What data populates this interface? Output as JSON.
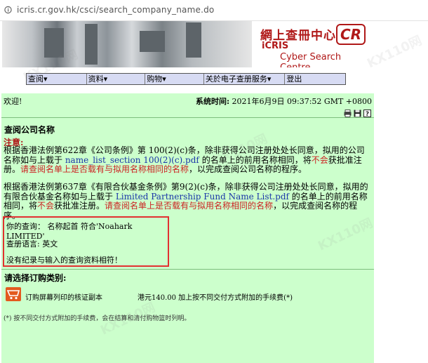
{
  "browser": {
    "url": "icris.cr.gov.hk/csci/search_company_name.do"
  },
  "banner": {
    "logo_zh": "網上查冊中心",
    "logo_cr": "CR",
    "logo_en_1": "iCRIS",
    "logo_en_2": "Cyber Search Centre"
  },
  "nav": [
    "查阅▾",
    "资料▾",
    "购物▾",
    "关於电子查册服务▾",
    "登出"
  ],
  "header": {
    "welcome": "欢迎!",
    "system_time_label": "系统时间:",
    "system_time_value": "2021年6月9日 09:37:52 GMT +0800"
  },
  "tools": [
    "printer-icon",
    "save-icon",
    "help-icon"
  ],
  "page": {
    "title": "查阅公司名称",
    "note_label": "注意:",
    "para1": {
      "text_a": "根据香港法例第622章《公司条例》第 100(2)(c)条，除非获得公司注册处处长同意，拟用的公司名称如与上载于 ",
      "link": "name_list_section 100(2)(c).pdf",
      "text_b": " 的名单上的前用名称相同，将",
      "red_a": "不会",
      "text_c": "获批准注册。",
      "red_b": "请查阅名单上是否载有与拟用名称相同的名称",
      "text_d": "，以完成查阅公司名称的程序。"
    },
    "para2": {
      "text_a": "根据香港法例第637章《有限合伙基金条例》第9(2)(c)条，除非获得公司注册处处长同意，拟用的有限合伙基金名称如与上载于 ",
      "link": "Limited Partnership Fund Name List.pdf",
      "text_b": " 的名单上的前用名称相同，将",
      "red_a": "不会",
      "text_c": "获批准注册。",
      "red_b": "请查阅名单上是否载有与拟用名称相同的名称",
      "text_d": "，以完成查阅名称的程序。"
    }
  },
  "query": {
    "your_query": "你的查询：  名称起首 符合'Noahark LIMITED'",
    "language": "查册语言: 英文",
    "result": "没有纪录与输入的查询资料相符！"
  },
  "order": {
    "choose_label": "请选择订购类别:",
    "item_label": "订购屏幕列印的核证副本",
    "item_price": "港元140.00 加上按不同交付方式附加的手续费(*)",
    "footnote": "(*) 按不同交付方式附加的手续费，会在结算和清付购物篮时列明。"
  },
  "watermark": "KX110网"
}
